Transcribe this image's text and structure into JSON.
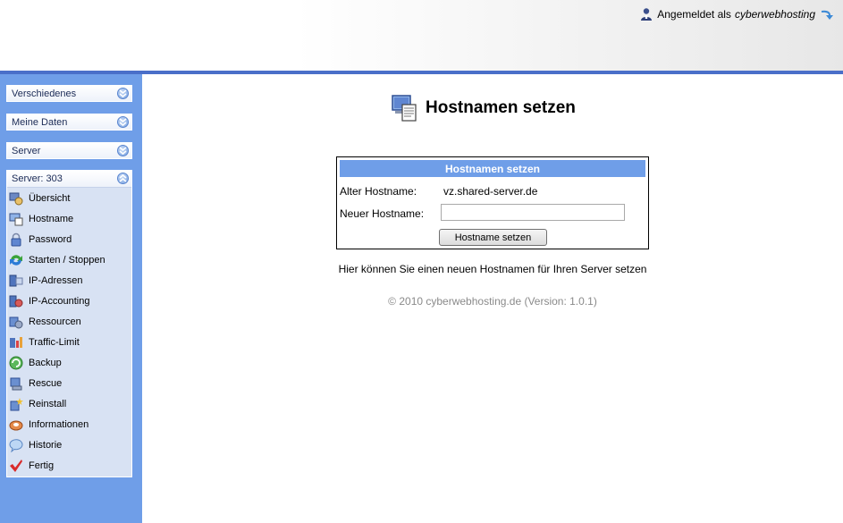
{
  "header": {
    "login_prefix": "Angemeldet als",
    "username": "cyberwebhosting",
    "icons": {
      "user": "user-icon",
      "logout": "logout-arrow-icon"
    }
  },
  "sidebar": {
    "sections": [
      {
        "label": "Verschiedenes",
        "state": "collapsed"
      },
      {
        "label": "Meine Daten",
        "state": "collapsed"
      },
      {
        "label": "Server",
        "state": "collapsed"
      }
    ],
    "server_panel": {
      "label": "Server: 303",
      "state": "expanded",
      "items": [
        {
          "label": "Übersicht",
          "icon": "overview-icon"
        },
        {
          "label": "Hostname",
          "icon": "hostname-icon"
        },
        {
          "label": "Password",
          "icon": "lock-icon"
        },
        {
          "label": "Starten / Stoppen",
          "icon": "start-stop-icon"
        },
        {
          "label": "IP-Adressen",
          "icon": "ip-address-icon"
        },
        {
          "label": "IP-Accounting",
          "icon": "ip-accounting-icon"
        },
        {
          "label": "Ressourcen",
          "icon": "resources-icon"
        },
        {
          "label": "Traffic-Limit",
          "icon": "traffic-limit-icon"
        },
        {
          "label": "Backup",
          "icon": "backup-icon"
        },
        {
          "label": "Rescue",
          "icon": "rescue-icon"
        },
        {
          "label": "Reinstall",
          "icon": "reinstall-icon"
        },
        {
          "label": "Informationen",
          "icon": "information-icon"
        },
        {
          "label": "Historie",
          "icon": "history-icon"
        },
        {
          "label": "Fertig",
          "icon": "checkmark-icon"
        }
      ]
    }
  },
  "main": {
    "heading": "Hostnamen setzen",
    "form": {
      "title": "Hostnamen setzen",
      "old_label": "Alter Hostname:",
      "old_value": "vz.shared-server.de",
      "new_label": "Neuer Hostname:",
      "new_value": "",
      "submit_label": "Hostname setzen"
    },
    "hint": "Hier können Sie einen neuen Hostnamen für Ihren Server setzen",
    "footer": "© 2010 cyberwebhosting.de (Version: 1.0.1)"
  },
  "colors": {
    "sidebar_bg": "#6f9ee8",
    "header_bar": "#4a6fc9",
    "panel_bg": "#d8e2f3",
    "form_head_bg": "#6f9ee8",
    "footer_text": "#8a8a8a"
  }
}
